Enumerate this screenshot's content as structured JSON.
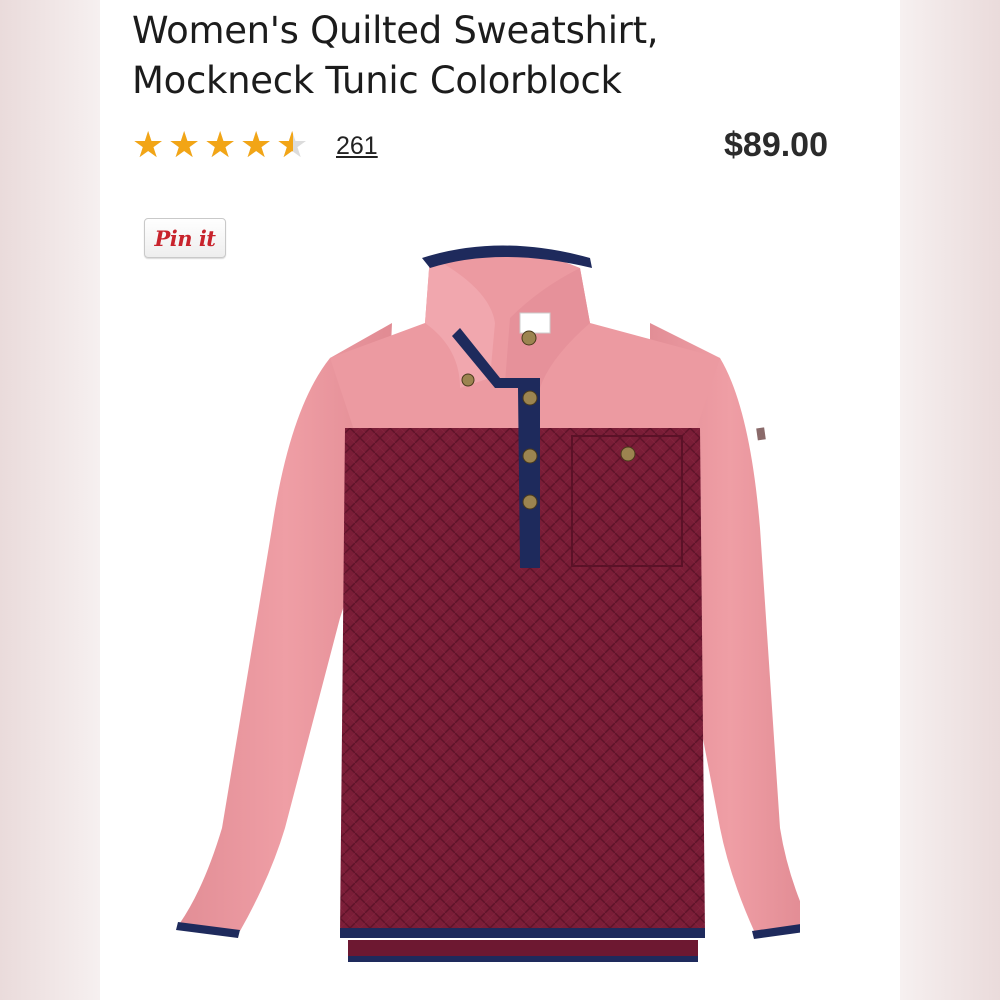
{
  "product": {
    "title_line1": "Women's Quilted Sweatshirt,",
    "title_line2": "Mockneck Tunic Colorblock",
    "rating": 4.5,
    "rating_max": 5,
    "review_count": "261",
    "price": "$89.00",
    "pin_label": "Pin it",
    "image_icon": "product-photo",
    "colors": {
      "accent_star": "#f2a516",
      "pink": "#e99aa0",
      "burgundy": "#7c1e38",
      "navy": "#1e2a5c",
      "pin_red": "#c8232c"
    }
  }
}
